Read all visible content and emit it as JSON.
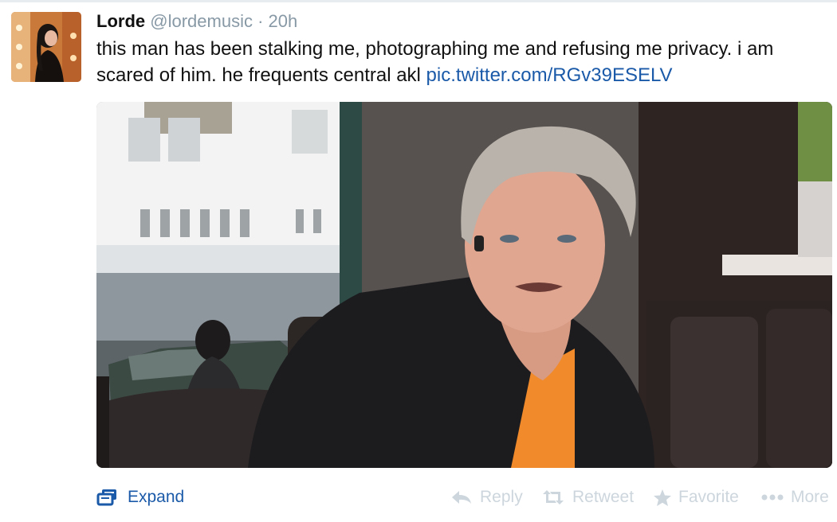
{
  "tweet": {
    "author_name": "Lorde",
    "author_handle": "@lordemusic",
    "separator": "·",
    "time": "20h",
    "text": "this man has been stalking me, photographing me and refusing me privacy. i am scared of him. he frequents central akl ",
    "link_text": "pic.twitter.com/RGv39ESELV"
  },
  "footer": {
    "expand_label": "Expand",
    "actions": {
      "reply": "Reply",
      "retweet": "Retweet",
      "favorite": "Favorite",
      "more": "More"
    }
  },
  "colors": {
    "link": "#1b5aa8",
    "muted": "#8899a6",
    "action": "#cdd6dd"
  }
}
